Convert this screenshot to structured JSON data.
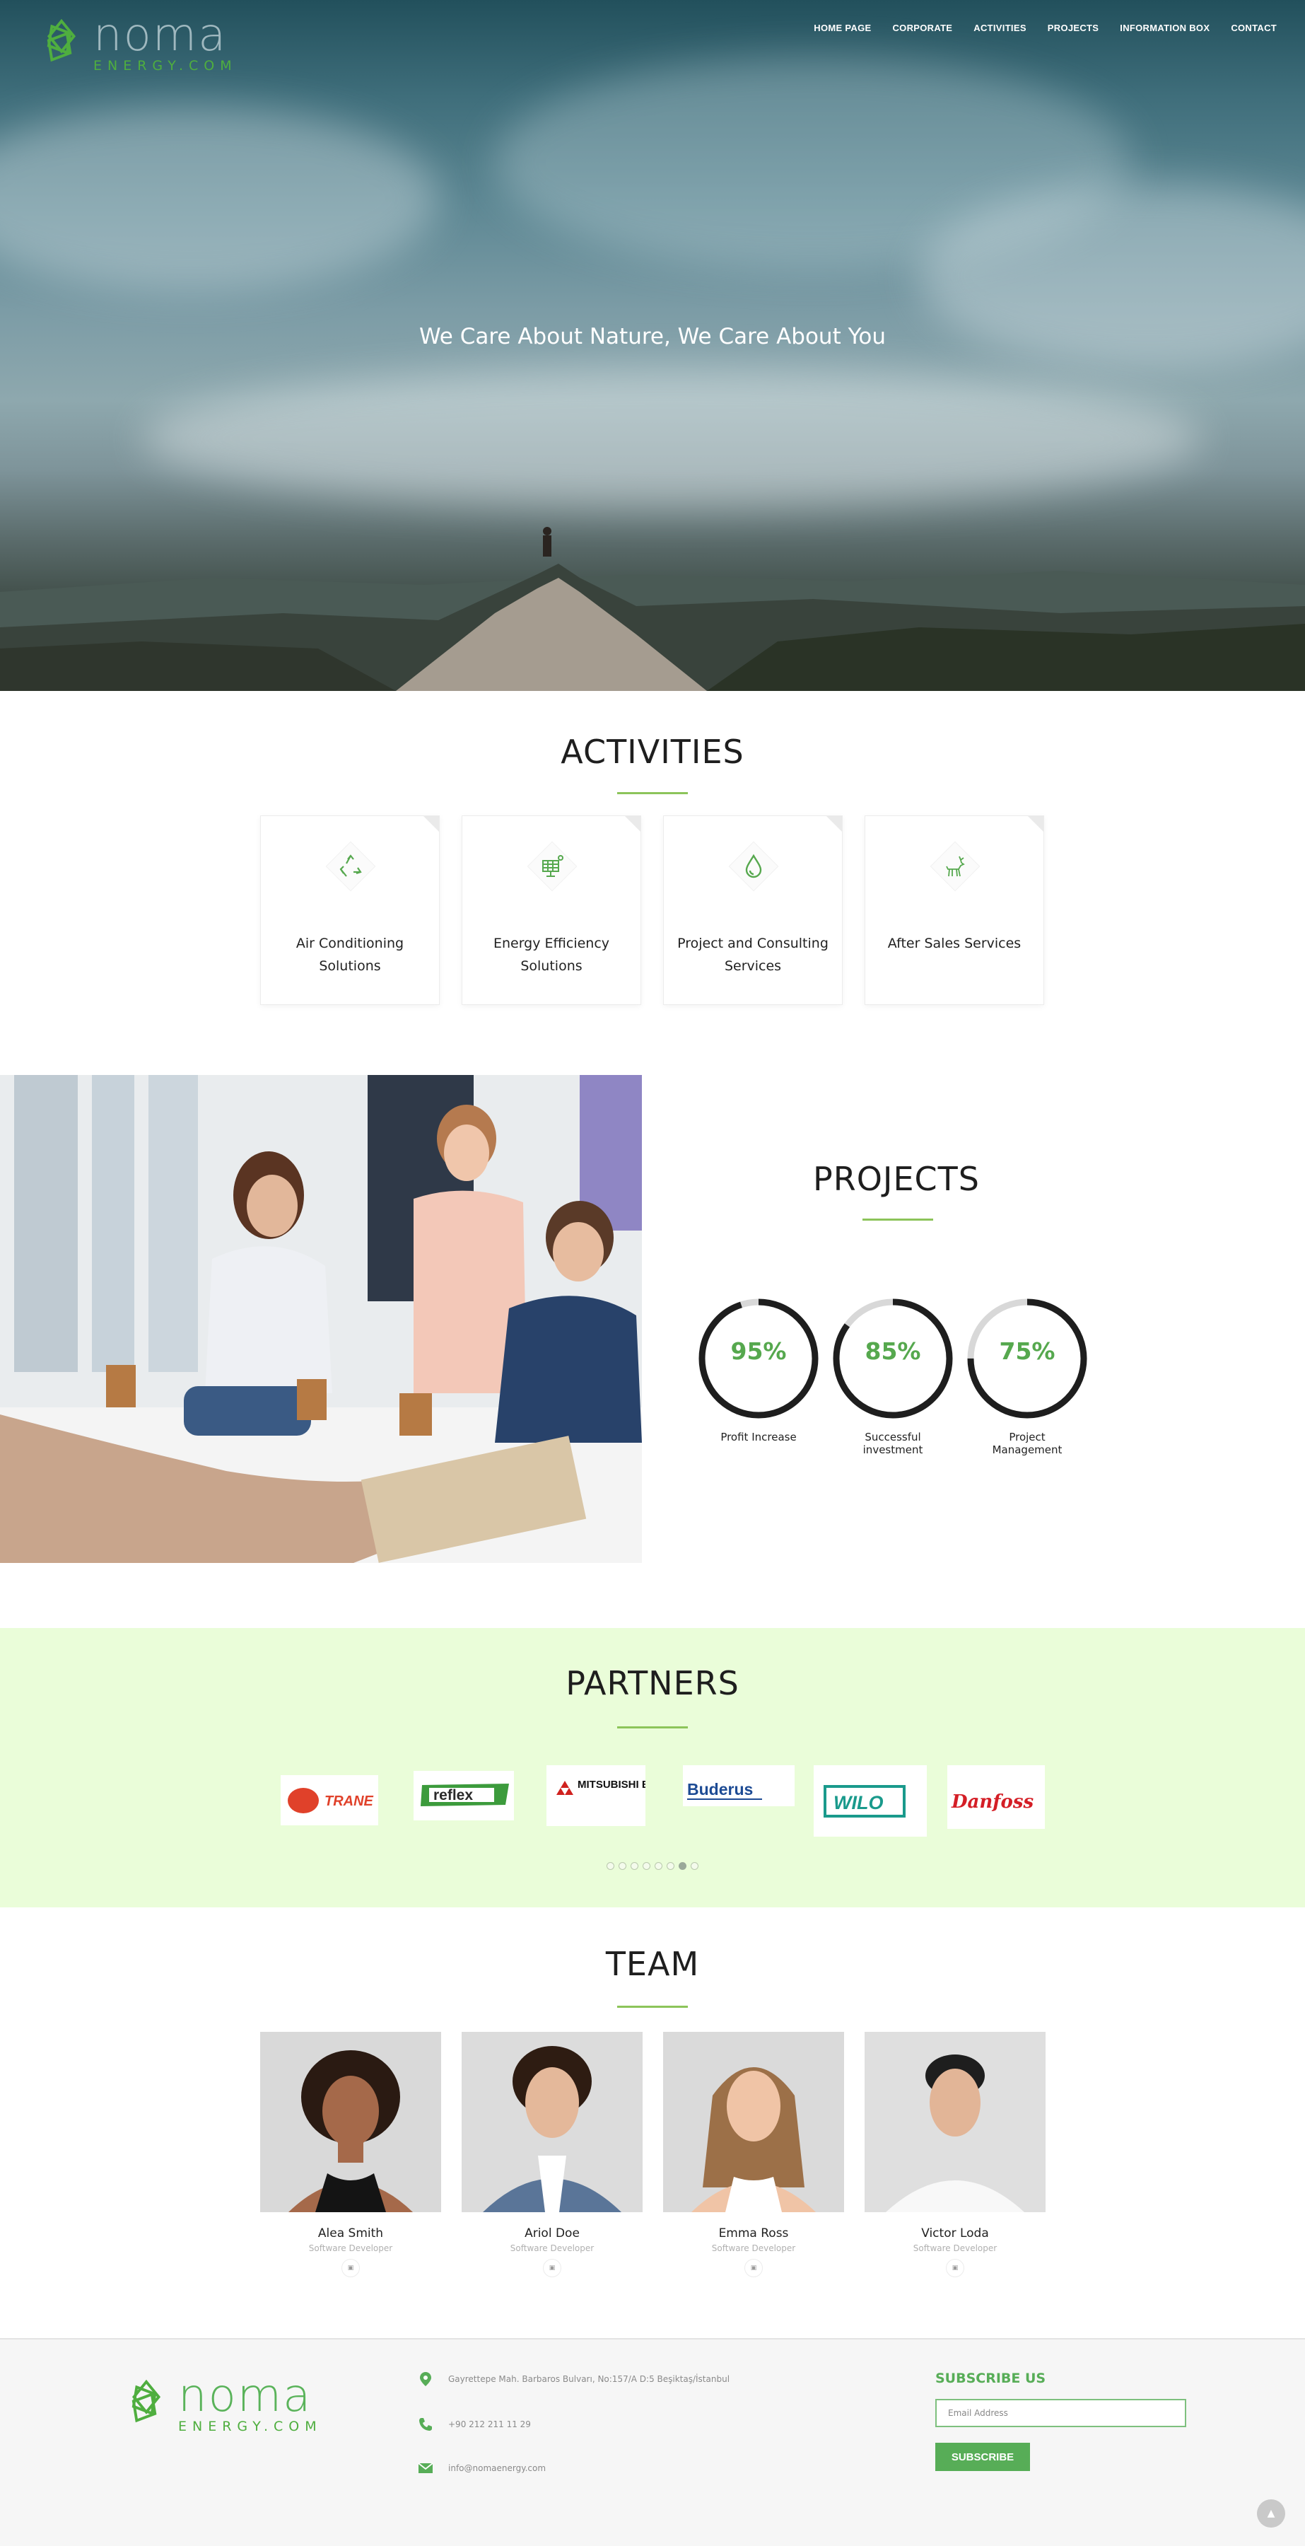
{
  "brand": {
    "name": "noma",
    "sub": "ENERGY.COM",
    "accent": "#4fae3f"
  },
  "nav": [
    "HOME PAGE",
    "CORPORATE",
    "ACTIVITIES",
    "PROJECTS",
    "INFORMATION BOX",
    "CONTACT"
  ],
  "hero": {
    "tagline": "We Care About Nature, We Care About You"
  },
  "activities": {
    "title": "ACTIVITIES",
    "items": [
      {
        "icon": "recycle-icon",
        "label": "Air Conditioning Solutions"
      },
      {
        "icon": "solar-panel-icon",
        "label": "Energy Efficiency Solutions"
      },
      {
        "icon": "water-drop-icon",
        "label": "Project and Consulting Services"
      },
      {
        "icon": "deer-icon",
        "label": "After Sales Services"
      }
    ]
  },
  "projects": {
    "title": "PROJECTS",
    "stats": [
      {
        "value": 95,
        "label": "95%",
        "caption": "Profit Increase"
      },
      {
        "value": 85,
        "label": "85%",
        "caption": "Successful investment"
      },
      {
        "value": 75,
        "label": "75%",
        "caption": "Project Management"
      }
    ]
  },
  "partners": {
    "title": "PARTNERS",
    "logos": [
      "TRANE",
      "reflex",
      "MITSUBISHI ELECTRIC",
      "Buderus",
      "WILO",
      "Danfoss"
    ],
    "dots": 8,
    "active_dot": 7
  },
  "team": {
    "title": "TEAM",
    "members": [
      {
        "name": "Alea Smith",
        "role": "Software Developer"
      },
      {
        "name": "Ariol Doe",
        "role": "Software Developer"
      },
      {
        "name": "Emma Ross",
        "role": "Software Developer"
      },
      {
        "name": "Victor Loda",
        "role": "Software Developer"
      }
    ]
  },
  "footer": {
    "address": "Gayrettepe Mah. Barbaros Bulvarı, No:157/A D:5 Beşiktaş/İstanbul",
    "phone": "+90 212 211 11 29",
    "email": "info@nomaenergy.com",
    "subscribe": {
      "title": "SUBSCRIBE US",
      "placeholder": "Email Address",
      "button": "SUBSCRIBE"
    }
  }
}
